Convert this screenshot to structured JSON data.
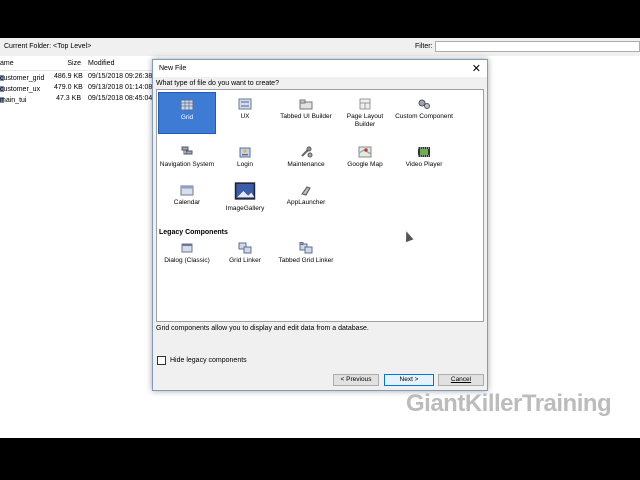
{
  "toolbar": {
    "folder_label": "Current Folder: <Top Level>",
    "filter_label": "Filter:",
    "filter_value": ""
  },
  "filelist": {
    "columns": [
      "ame",
      "Size",
      "Modified"
    ],
    "rows": [
      {
        "name": "customer_grid",
        "size": "486.9 KB",
        "modified": "09/15/2018 09:26:38"
      },
      {
        "name": "customer_ux",
        "size": "479.0 KB",
        "modified": "09/13/2018 01:14:08"
      },
      {
        "name": "main_tui",
        "size": "47.3 KB",
        "modified": "09/15/2018 08:45:04"
      }
    ]
  },
  "dialog": {
    "title": "New File",
    "close": "✕",
    "prompt": "What type of file do you want to create?",
    "items": [
      {
        "label": "Grid",
        "icon": "grid-icon",
        "selected": true
      },
      {
        "label": "UX",
        "icon": "ux-icon"
      },
      {
        "label": "Tabbed UI Builder",
        "icon": "tabbed-ui-builder-icon"
      },
      {
        "label": "Page Layout Builder",
        "icon": "page-layout-builder-icon"
      },
      {
        "label": "Custom Component",
        "icon": "custom-component-icon"
      },
      {
        "label": "Navigation System",
        "icon": "navigation-system-icon"
      },
      {
        "label": "Login",
        "icon": "login-icon"
      },
      {
        "label": "Maintenance",
        "icon": "maintenance-icon"
      },
      {
        "label": "Google Map",
        "icon": "google-map-icon"
      },
      {
        "label": "Video Player",
        "icon": "video-player-icon"
      },
      {
        "label": "Calendar",
        "icon": "calendar-icon"
      },
      {
        "label": "ImageGallery",
        "icon": "image-gallery-icon"
      },
      {
        "label": "AppLauncher",
        "icon": "app-launcher-icon"
      }
    ],
    "legacy_heading": "Legacy Components",
    "legacy_items": [
      {
        "label": "Dialog (Classic)",
        "icon": "dialog-classic-icon"
      },
      {
        "label": "Grid Linker",
        "icon": "grid-linker-icon"
      },
      {
        "label": "Tabbed Grid Linker",
        "icon": "tabbed-grid-linker-icon"
      }
    ],
    "description": "Grid components allow you to display and edit data from a database.",
    "hide_legacy_label": "Hide legacy components",
    "buttons": {
      "previous": "< Previous",
      "next": "Next >",
      "cancel": "Cancel"
    }
  },
  "watermark": "GiantKillerTraining",
  "colors": {
    "selection": "#3d7bd5",
    "dialog_bg": "#f0f0f0",
    "accent": "#0078d7"
  }
}
